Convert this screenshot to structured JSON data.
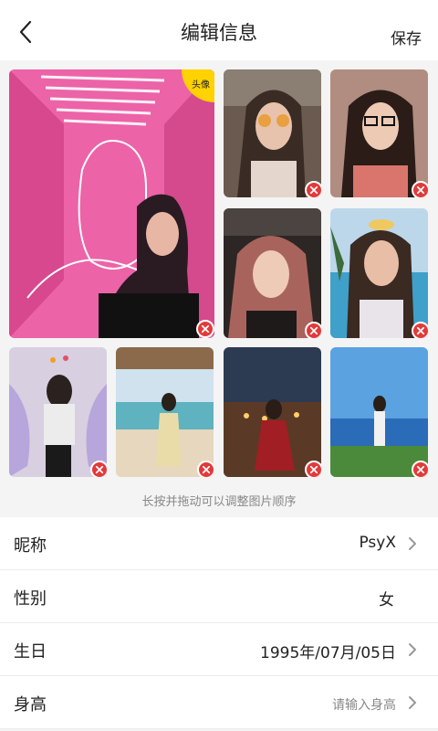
{
  "header": {
    "title": "编辑信息",
    "save_label": "保存"
  },
  "photos": {
    "avatar_badge": "头像",
    "hint": "长按并拖动可以调整图片顺序"
  },
  "fields": {
    "nickname": {
      "label": "昵称",
      "value": "PsyX"
    },
    "gender": {
      "label": "性别",
      "value": "女"
    },
    "birthday": {
      "label": "生日",
      "value": "1995年/07月/05日"
    },
    "height": {
      "label": "身高",
      "placeholder": "请输入身高"
    }
  },
  "colors": {
    "delete": "#e23a3a",
    "badge": "#ffd200",
    "accent": "#222222"
  }
}
